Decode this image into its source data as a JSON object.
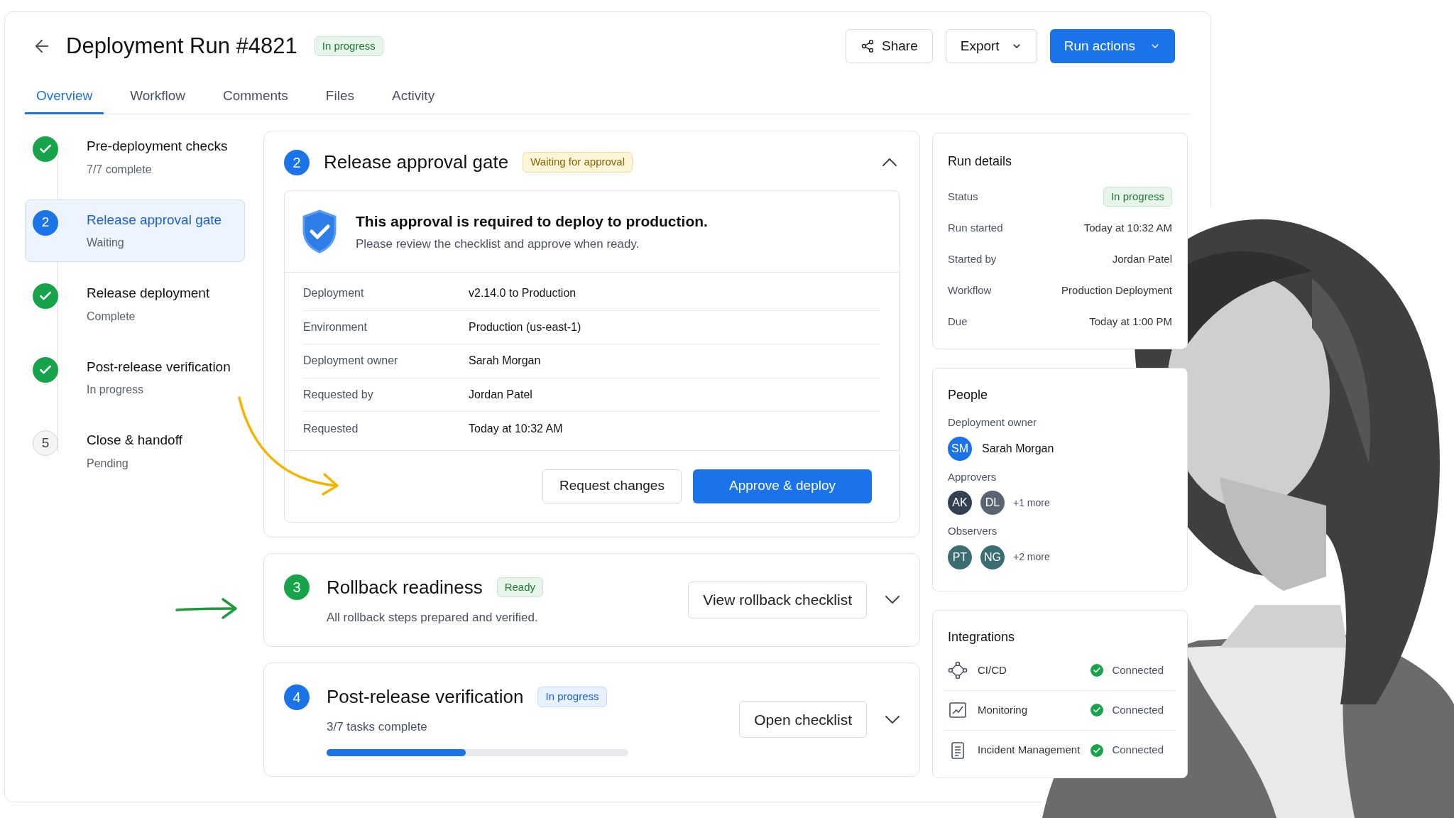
{
  "header": {
    "title": "Deployment Run #4821",
    "status": {
      "label": "In progress",
      "kind": "green"
    },
    "actions": [
      {
        "label": "Share",
        "kind": "share"
      },
      {
        "label": "Export",
        "kind": "dropdown"
      },
      {
        "label": "Run actions",
        "kind": "primary"
      }
    ]
  },
  "tabs": [
    {
      "label": "Overview",
      "selected": true
    },
    {
      "label": "Workflow",
      "selected": false
    },
    {
      "label": "Comments",
      "selected": false
    },
    {
      "label": "Files",
      "selected": false
    },
    {
      "label": "Activity",
      "selected": false
    }
  ],
  "steps": [
    {
      "title": "Pre-deployment checks",
      "subtitle": "7/7 complete",
      "kind": "done",
      "selected": false
    },
    {
      "number": "2",
      "title": "Release approval gate",
      "subtitle": "Waiting",
      "kind": "current",
      "selected": true
    },
    {
      "title": "Release deployment",
      "subtitle": "Complete",
      "kind": "done",
      "selected": false
    },
    {
      "title": "Post-release verification",
      "subtitle": "In progress",
      "kind": "done",
      "selected": false
    },
    {
      "number": "5",
      "title": "Close & handoff",
      "subtitle": "Pending",
      "kind": "pending",
      "selected": false
    }
  ],
  "approval_card": {
    "number": "2",
    "title": "Release approval gate",
    "badge": {
      "label": "Waiting for approval",
      "kind": "amber"
    },
    "expanded": true,
    "notice": {
      "title": "This approval is required to deploy to production.",
      "text": "Please review the checklist and approve when ready."
    },
    "details": [
      {
        "label": "Deployment",
        "value": "v2.14.0 to Production"
      },
      {
        "label": "Environment",
        "value": "Production (us-east-1)"
      },
      {
        "label": "Deployment owner",
        "value": "Sarah Morgan"
      },
      {
        "label": "Requested by",
        "value": "Jordan Patel"
      },
      {
        "label": "Requested",
        "value": "Today at 10:32 AM"
      }
    ],
    "buttons": [
      {
        "label": "Request changes",
        "kind": "secondary"
      },
      {
        "label": "Approve & deploy",
        "kind": "primary"
      }
    ]
  },
  "stage_cards": [
    {
      "number": "3",
      "color": "#16a34a",
      "title": "Rollback readiness",
      "badge": {
        "label": "Ready",
        "kind": "green"
      },
      "text": "All rollback steps prepared and verified.",
      "button": "View rollback checklist",
      "expanded": false
    },
    {
      "number": "4",
      "color": "#1a73e8",
      "title": "Post-release verification",
      "badge": {
        "label": "In progress",
        "kind": "blue"
      },
      "text": "3/7 tasks complete",
      "level": 0.46,
      "button": "Open checklist",
      "expanded": false
    }
  ],
  "run_details": {
    "title": "Run details",
    "rows": [
      {
        "label": "Status",
        "value": "In progress",
        "kind": "badge"
      },
      {
        "label": "Run started",
        "value": "Today at 10:32 AM",
        "kind": "text"
      },
      {
        "label": "Started by",
        "value": "Jordan Patel",
        "kind": "text"
      },
      {
        "label": "Workflow",
        "value": "Production Deployment",
        "kind": "text"
      },
      {
        "label": "Due",
        "value": "Today at 1:00 PM",
        "kind": "text"
      }
    ]
  },
  "people": {
    "title": "People",
    "groups": [
      {
        "label": "Deployment owner",
        "avatars": [
          {
            "initials": "SM",
            "color": "#1a73e8"
          }
        ],
        "name": "Sarah Morgan"
      },
      {
        "label": "Approvers",
        "avatars": [
          {
            "initials": "AK",
            "color": "#334155"
          },
          {
            "initials": "DL",
            "color": "#5b6472"
          }
        ],
        "more": "+1 more"
      },
      {
        "label": "Observers",
        "avatars": [
          {
            "initials": "PT",
            "color": "#3b6e73"
          },
          {
            "initials": "NG",
            "color": "#3b6e73"
          }
        ],
        "more": "+2 more"
      }
    ]
  },
  "integrations": {
    "title": "Integrations",
    "items": [
      {
        "name": "CI/CD",
        "kind": "pipeline",
        "status": "Connected"
      },
      {
        "name": "Monitoring",
        "kind": "chart",
        "status": "Connected"
      },
      {
        "name": "Incident Management",
        "kind": "document",
        "status": "Connected"
      }
    ]
  }
}
